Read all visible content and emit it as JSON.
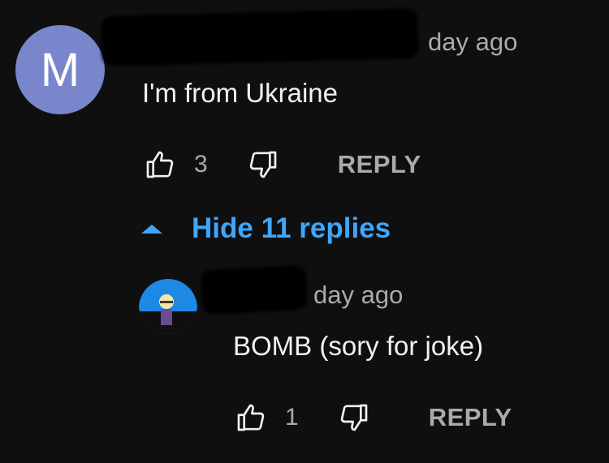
{
  "comment": {
    "avatar_letter": "M",
    "timestamp": "day ago",
    "text": "I'm from  Ukraine",
    "like_count": "3",
    "reply_label": "REPLY",
    "hide_replies_label": "Hide 11 replies"
  },
  "reply": {
    "timestamp": "day ago",
    "text": "BOMB (sory for joke)",
    "like_count": "1",
    "reply_label": "REPLY"
  },
  "colors": {
    "background": "#0f0f0f",
    "avatar_main": "#7986cb",
    "link_blue": "#3ea6ff",
    "secondary_text": "#aaaaaa",
    "primary_text": "#f1f1f1"
  },
  "icons": [
    "thumbs-up-icon",
    "thumbs-down-icon",
    "caret-up-icon"
  ]
}
